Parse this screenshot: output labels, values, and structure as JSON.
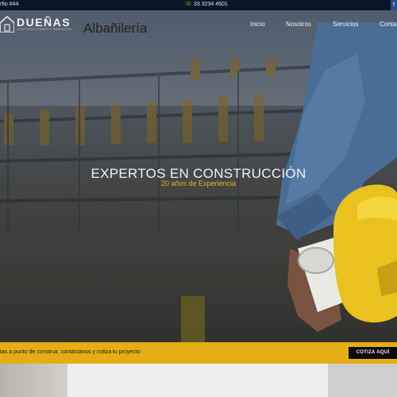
{
  "topbar": {
    "address": "rfio #44",
    "phone": "33 3234 4601",
    "phone_icon": "phone-icon",
    "social_icon": "facebook-icon"
  },
  "brand": {
    "name": "DUEÑAS",
    "tagline": "CONSTRUCCIONES Y SERVICIOS",
    "logo_icon": "house-logo-icon"
  },
  "nav": {
    "items": [
      {
        "label": "Inicio"
      },
      {
        "label": "Nosotros"
      },
      {
        "label": "Servicios"
      },
      {
        "label": "Conta"
      }
    ]
  },
  "hero": {
    "title": "EXPERTOS EN CONSTRUCCIÓN",
    "subtitle": "20 años de Experiencia"
  },
  "cta": {
    "text": "tas a punto de construir, contáctanos y cotiza tu proyecto",
    "button": "COTIZA AQUÍ"
  },
  "services": {
    "first_title": "Albañilería"
  },
  "colors": {
    "accent": "#e5ae16",
    "topbar": "#0a1628"
  }
}
